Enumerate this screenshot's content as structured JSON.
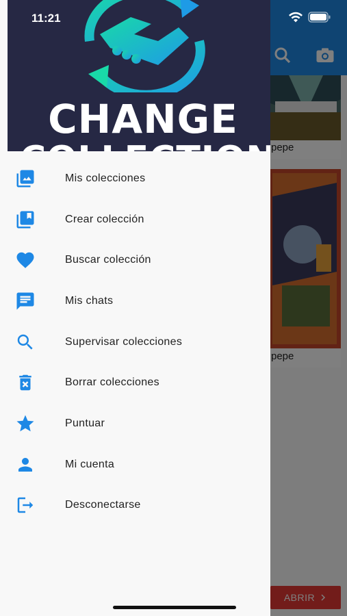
{
  "status_bar": {
    "time": "11:21"
  },
  "drawer": {
    "logo_line1": "CHANGE",
    "logo_line2": "COLLECTIONS",
    "items": [
      {
        "label": "Mis colecciones",
        "icon": "photo-library-icon"
      },
      {
        "label": "Crear colección",
        "icon": "library-add-icon"
      },
      {
        "label": "Buscar colección",
        "icon": "heart-icon"
      },
      {
        "label": "Mis chats",
        "icon": "chat-icon"
      },
      {
        "label": "Supervisar colecciones",
        "icon": "search-icon"
      },
      {
        "label": "Borrar colecciones",
        "icon": "delete-icon"
      },
      {
        "label": "Puntuar",
        "icon": "star-icon"
      },
      {
        "label": "Mi cuenta",
        "icon": "person-icon"
      },
      {
        "label": "Desconectarse",
        "icon": "logout-icon"
      }
    ]
  },
  "background": {
    "cards": [
      {
        "name": "pepe"
      },
      {
        "name": "pepe"
      }
    ],
    "open_button": "ABRIR"
  },
  "colors": {
    "accent": "#1e88e5",
    "drawer_header": "#262844",
    "open_button": "#e53935"
  }
}
